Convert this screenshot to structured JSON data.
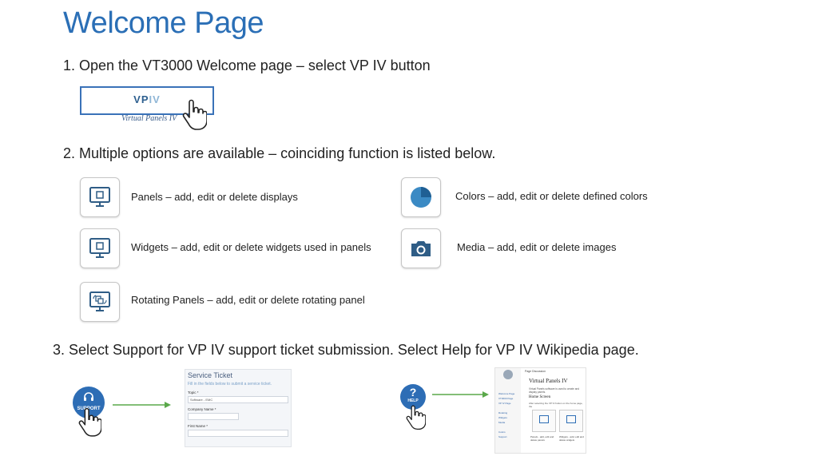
{
  "title": "Welcome Page",
  "steps": {
    "step1": "1. Open the VT3000 Welcome page – select VP IV button",
    "step2": "2. Multiple options are available – coinciding function is listed below.",
    "step3": "3. Select Support for VP IV support ticket submission. Select Help for VP IV Wikipedia page."
  },
  "vpiv_button": {
    "logo_vp": "VP",
    "logo_iv": "IV",
    "subtitle": "Virtual Panels IV"
  },
  "options": {
    "panels": "Panels – add, edit or delete displays",
    "widgets": "Widgets – add, edit or delete widgets used in panels",
    "rotating": "Rotating Panels – add, edit or delete rotating panel",
    "colors": "Colors – add, edit or delete defined colors",
    "media": "Media – add, edit or delete images"
  },
  "support": {
    "label": "SUPPORT"
  },
  "ticket": {
    "title": "Service Ticket",
    "hint": "Fill in the fields below to submit a service ticket.",
    "topic_label": "Topic *",
    "topic_value": "Software - EMC",
    "company_label": "Company Name *",
    "first_name_label": "First Name *"
  },
  "help": {
    "glyph": "?",
    "label": "HELP"
  },
  "wiki": {
    "tab": "Page   Discussion",
    "heading": "Virtual Panels IV",
    "intro": "Virtual Panels software is used to create and display panels.",
    "subheading": "Home Screen",
    "text": "After selecting the VP IV button on the home page, the",
    "caption_panels": "Panels - add, edit and delete panels",
    "caption_widgets": "Widgets - add, edit and delete widgets",
    "side_links": [
      "Welcome Page",
      "VT3000 Page",
      "VP IV Page",
      "Rotating",
      "Widgets",
      "Media",
      "Colors",
      "Support"
    ]
  },
  "icons": {
    "panels": "monitor-icon",
    "widgets": "monitor-icon",
    "rotating": "rotating-monitor-icon",
    "colors": "pie-chart-icon",
    "media": "camera-icon",
    "hand": "pointer-hand-icon",
    "arrow": "right-arrow-icon"
  },
  "colors": {
    "title": "#2b6fb6",
    "accent": "#2d6db5",
    "arrow": "#5aa84a"
  }
}
